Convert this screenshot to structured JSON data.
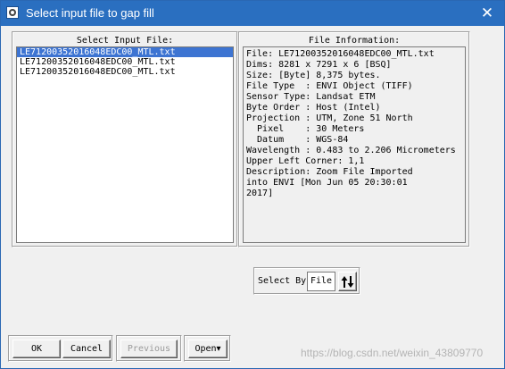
{
  "window": {
    "title": "Select input file to gap fill",
    "close_symbol": "✕"
  },
  "input_panel": {
    "label": "Select Input File:",
    "files": [
      {
        "name": "LE71200352016048EDC00_MTL.txt",
        "selected": true
      },
      {
        "name": "LE71200352016048EDC00_MTL.txt",
        "selected": false
      },
      {
        "name": "LE71200352016048EDC00_MTL.txt",
        "selected": false
      }
    ]
  },
  "info_panel": {
    "label": "File Information:",
    "lines": [
      "File: LE71200352016048EDC00_MTL.txt",
      "Dims: 8281 x 7291 x 6 [BSQ]",
      "Size: [Byte] 8,375 bytes.",
      "File Type  : ENVI Object (TIFF)",
      "Sensor Type: Landsat ETM",
      "Byte Order : Host (Intel)",
      "Projection : UTM, Zone 51 North",
      "  Pixel    : 30 Meters",
      "  Datum    : WGS-84",
      "Wavelength : 0.483 to 2.206 Micrometers",
      "Upper Left Corner: 1,1",
      "Description: Zoom File Imported",
      "into ENVI [Mon Jun 05 20:30:01",
      "2017]"
    ]
  },
  "select_by": {
    "label": "Select By",
    "value": "File",
    "sort_icon": "sort-updown-icon"
  },
  "buttons": {
    "ok": "OK",
    "cancel": "Cancel",
    "previous": "Previous",
    "open": "Open",
    "open_arrow": "▾"
  },
  "watermark": "https://blog.csdn.net/weixin_43809770",
  "colors": {
    "titlebar": "#2a6fc0",
    "selection": "#3d74d2",
    "dialog_bg": "#f0f0f0"
  }
}
